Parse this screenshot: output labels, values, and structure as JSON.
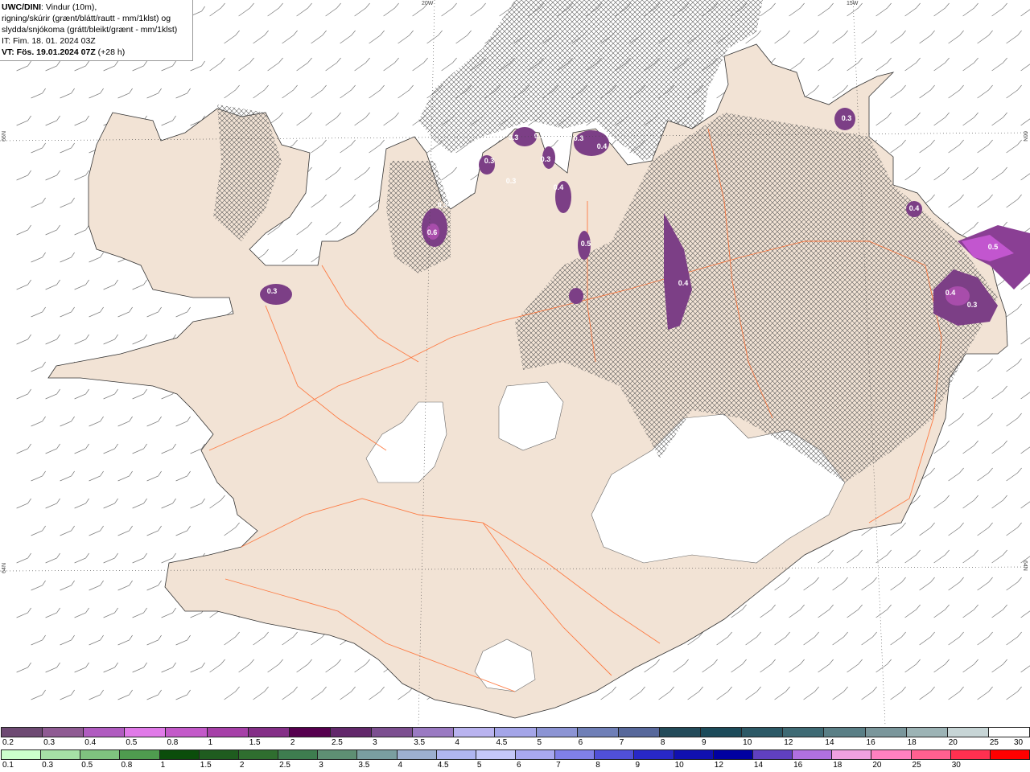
{
  "title": {
    "model": "UWC/DINI",
    "line1_rest": ": Vindur (10m),",
    "line2": "rigning/skúrir (grænt/blátt/rautt - mm/1klst) og",
    "line3": "slydda/snjókoma (grátt/bleikt/grænt - mm/1klst)",
    "it": "IT: Fim. 18. 01. 2024 03Z",
    "vt_bold": "VT: Fös. 19.01.2024 07Z",
    "vt_rest": " (+28 h)"
  },
  "grid_labels": {
    "lon_20w": "20W",
    "lon_15w": "15W",
    "lat_66n_left": "66N",
    "lat_66n_right": "66N",
    "lat_64n_left": "64N",
    "lat_64n_right": "64N"
  },
  "precip_labels": [
    {
      "text": "0.3",
      "id": "vestfirdir"
    },
    {
      "text": "0.6",
      "id": "skagi"
    },
    {
      "text": "0.3",
      "id": "skagi-n"
    },
    {
      "text": "0.3",
      "id": "trollaskagi-w"
    },
    {
      "text": "0.3",
      "id": "siglufjordur"
    },
    {
      "text": "0.3",
      "id": "olafsfjordur"
    },
    {
      "text": "0.3",
      "id": "trollaskagi-s"
    },
    {
      "text": "0.3",
      "id": "flateyjarskagi"
    },
    {
      "text": "0.4",
      "id": "tjornes"
    },
    {
      "text": "0.4",
      "id": "husavik"
    },
    {
      "text": "0.5",
      "id": "eyjafjordur"
    },
    {
      "text": "0.3",
      "id": "bardardalur"
    },
    {
      "text": "0.4",
      "id": "myvatn"
    },
    {
      "text": "0.3",
      "id": "langanes"
    },
    {
      "text": "0.4",
      "id": "vopnafjordur"
    },
    {
      "text": "0.5",
      "id": "austfirdir-n"
    },
    {
      "text": "0.4",
      "id": "austfirdir-mid"
    },
    {
      "text": "0.3",
      "id": "austfirdir-s"
    }
  ],
  "legend": {
    "snow_colors": [
      "#6e4a73",
      "#8f5b93",
      "#b05cc0",
      "#e07ae8",
      "#c35ac9",
      "#a640a8",
      "#842f87",
      "#56004f",
      "#62286b",
      "#7c4f90",
      "#9a7ac2",
      "#b9b3ef",
      "#a4a5e8",
      "#8c94d4",
      "#6f7fb7",
      "#57689b",
      "#234b5a",
      "#1c4b5a",
      "#2c5966",
      "#3e6a74",
      "#5a7f86",
      "#7a969b",
      "#9cb3b5",
      "#c7d5d6",
      "#ffffff"
    ],
    "snow_labels": [
      "0.2",
      "0.3",
      "0.4",
      "0.5",
      "0.8",
      "1",
      "1.5",
      "2",
      "2.5",
      "3",
      "3.5",
      "4",
      "4.5",
      "5",
      "6",
      "7",
      "8",
      "9",
      "10",
      "12",
      "14",
      "16",
      "18",
      "20",
      "25",
      "30"
    ],
    "rain_colors": [
      "#ccffcc",
      "#a6e0a6",
      "#7fc27f",
      "#4f9c4f",
      "#0b4d0b",
      "#1f5c1f",
      "#2f6e2f",
      "#3e7d4f",
      "#5e8f73",
      "#7a9fa0",
      "#9db0d0",
      "#b0b6f0",
      "#c5c8f8",
      "#a8a8f0",
      "#8080e8",
      "#5050d8",
      "#2828c8",
      "#1010b0",
      "#0000a0",
      "#6040c0",
      "#b070e0",
      "#f0a0e0",
      "#ff80c0",
      "#ff6090",
      "#ff3050",
      "#ff0000"
    ],
    "rain_labels": [
      "0.1",
      "0.3",
      "0.5",
      "0.8",
      "1",
      "1.5",
      "2",
      "2.5",
      "3",
      "3.5",
      "4",
      "4.5",
      "5",
      "6",
      "7",
      "8",
      "9",
      "10",
      "12",
      "14",
      "16",
      "18",
      "20",
      "25",
      "30"
    ]
  }
}
